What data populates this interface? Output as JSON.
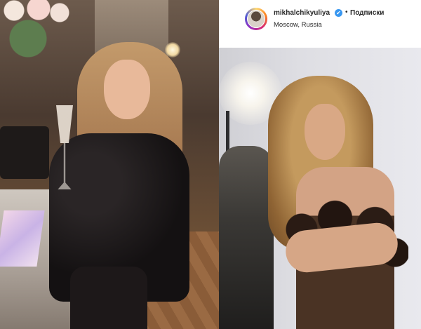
{
  "post": {
    "username": "mikhalchikyuliya",
    "verified_glyph": "✔",
    "separator": "•",
    "follow_label": "Подписки",
    "location": "Moscow, Russia"
  },
  "icons": [
    "verified-badge-icon"
  ],
  "colors": {
    "verified": "#3897f0",
    "text": "#262626",
    "background": "#ffffff"
  }
}
